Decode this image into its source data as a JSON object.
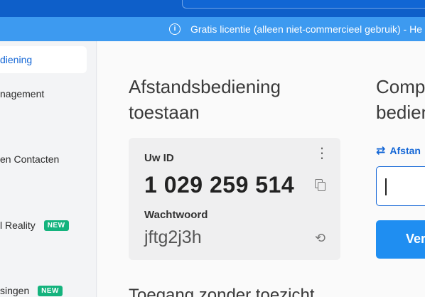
{
  "banner": {
    "icon": "info-icon",
    "text": "Gratis licentie (alleen niet-commercieel gebruik) - He"
  },
  "sidebar": {
    "items": [
      {
        "label": "diening",
        "active": true
      },
      {
        "label": "nagement"
      },
      {
        "label": "en Contacten"
      },
      {
        "label": "l Reality",
        "badge": "NEW"
      },
      {
        "label": "singen",
        "badge": "NEW"
      }
    ]
  },
  "main": {
    "section_title": "Afstandsbediening toestaan",
    "card": {
      "id_label": "Uw ID",
      "id_value": "1 029 259 514",
      "password_label": "Wachtwoord",
      "password_value": "jftg2j3h",
      "icons": [
        "more-vertical-icon",
        "copy-icon",
        "refresh-icon"
      ]
    },
    "next_section_title": "Toegang zonder toezicht",
    "right": {
      "title_line1": "Comp",
      "title_line2": "bedien",
      "link_label": "Afstan",
      "link_icon": "swap-arrows-icon",
      "input_value": "",
      "button_label": "Ver"
    }
  },
  "colors": {
    "topbar": "#0e5fc9",
    "banner": "#3d9af0",
    "accent": "#1366d6",
    "new_badge": "#14b37d",
    "button": "#1f8ef1"
  }
}
